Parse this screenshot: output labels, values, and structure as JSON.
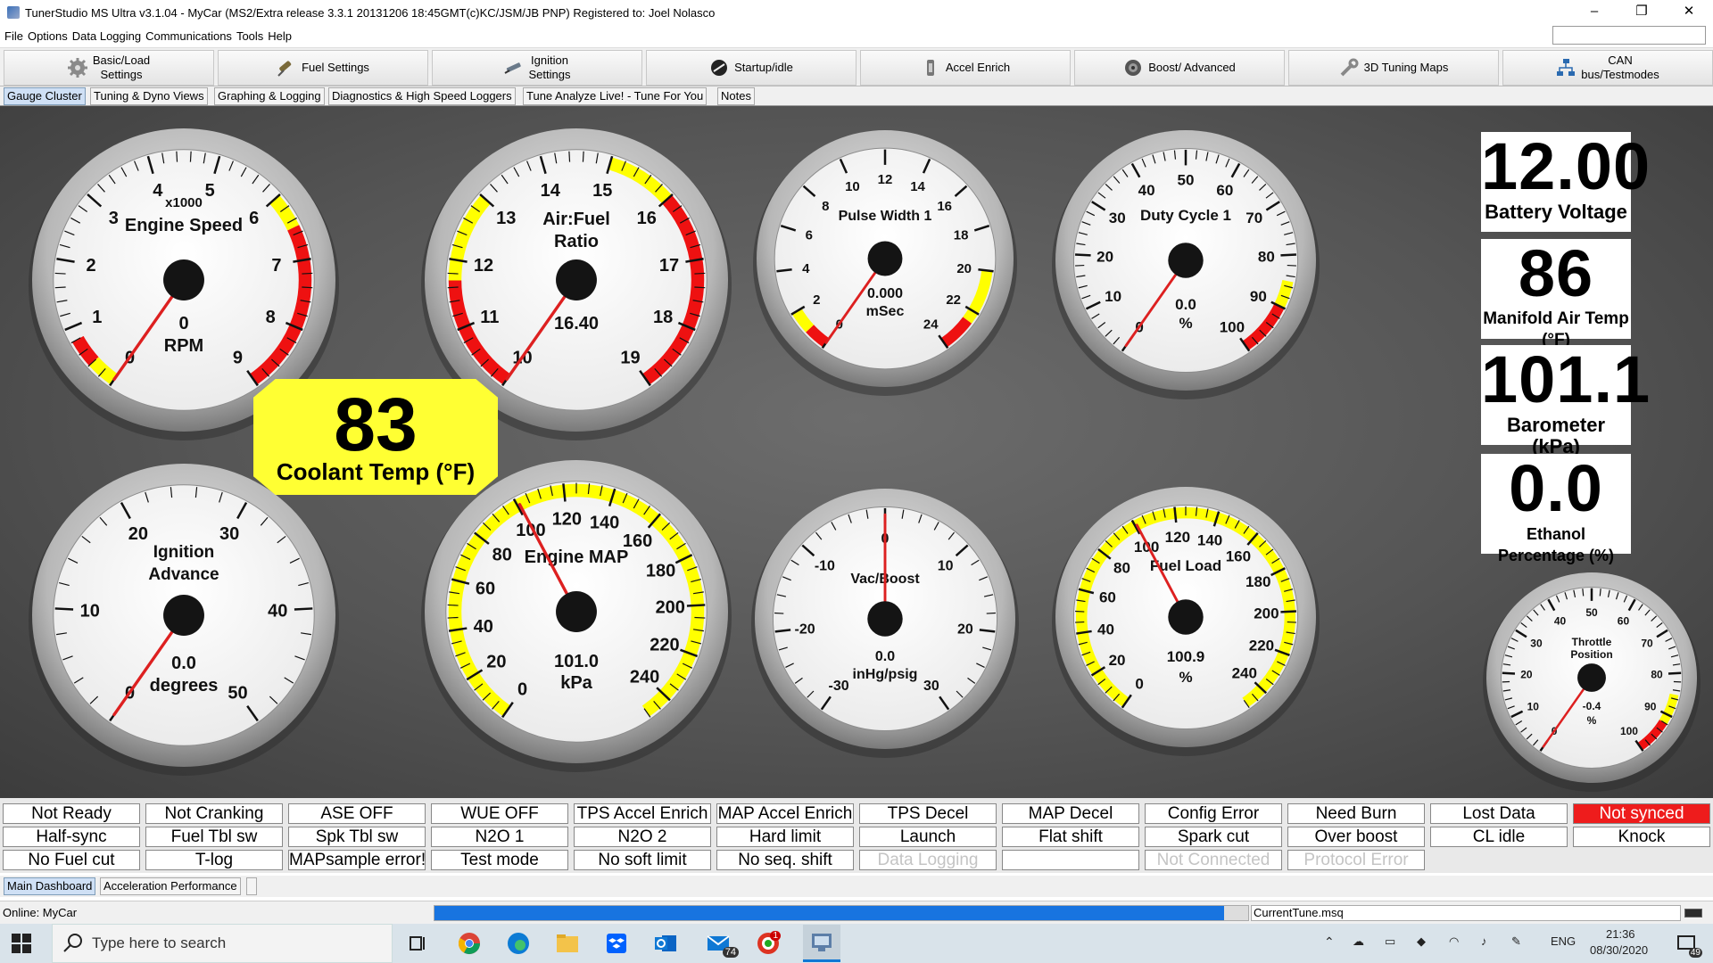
{
  "window": {
    "title": "TunerStudio MS Ultra v3.1.04 - MyCar (MS2/Extra release 3.3.1  20131206 18:45GMT(c)KC/JSM/JB   PNP) Registered to: Joel Nolasco",
    "minimize": "–",
    "maximize": "❐",
    "close": "✕"
  },
  "menu": [
    "File",
    "Options",
    "Data Logging",
    "Communications",
    "Tools",
    "Help"
  ],
  "toolbar": [
    {
      "label": "Basic/Load\nSettings",
      "icon": "gear-icon"
    },
    {
      "label": "Fuel Settings",
      "icon": "fuel-injector-icon"
    },
    {
      "label": "Ignition\nSettings",
      "icon": "spark-plug-icon"
    },
    {
      "label": "Startup/idle",
      "icon": "startup-icon"
    },
    {
      "label": "Accel Enrich",
      "icon": "throttle-icon"
    },
    {
      "label": "Boost/ Advanced",
      "icon": "turbo-icon"
    },
    {
      "label": "3D Tuning Maps",
      "icon": "wrench-icon"
    },
    {
      "label": "CAN\nbus/Testmodes",
      "icon": "network-icon"
    }
  ],
  "tabs": [
    "Gauge Cluster",
    "Tuning & Dyno Views",
    "Graphing & Logging",
    "Diagnostics & High Speed Loggers",
    "Tune Analyze Live! - Tune For You",
    "Notes"
  ],
  "active_tab": "Gauge Cluster",
  "gauges": {
    "engine_speed": {
      "title1": "x1000",
      "title2": "Engine Speed",
      "value": "0",
      "units": "RPM",
      "ticks": [
        "0",
        "1",
        "2",
        "3",
        "4",
        "5",
        "6",
        "7",
        "8",
        "9"
      ]
    },
    "afr": {
      "title1": "Air:Fuel",
      "title2": "Ratio",
      "value": "16.40",
      "units": "",
      "ticks": [
        "10",
        "11",
        "12",
        "13",
        "14",
        "15",
        "16",
        "17",
        "18",
        "19"
      ]
    },
    "pulse_width": {
      "title1": "Pulse Width 1",
      "value": "0.000",
      "units": "mSec",
      "ticks": [
        "0",
        "2",
        "4",
        "6",
        "8",
        "10",
        "12",
        "14",
        "16",
        "18",
        "20",
        "22",
        "24"
      ]
    },
    "duty_cycle": {
      "title1": "Duty Cycle 1",
      "value": "0.0",
      "units": "%",
      "ticks": [
        "0",
        "10",
        "20",
        "30",
        "40",
        "50",
        "60",
        "70",
        "80",
        "90",
        "100"
      ]
    },
    "ignition_advance": {
      "title1": "Ignition",
      "title2": "Advance",
      "value": "0.0",
      "units": "degrees",
      "ticks": [
        "0",
        "10",
        "20",
        "30",
        "40",
        "50"
      ]
    },
    "engine_map": {
      "title1": "Engine MAP",
      "value": "101.0",
      "units": "kPa",
      "ticks": [
        "0",
        "20",
        "40",
        "60",
        "80",
        "100",
        "120",
        "140",
        "160",
        "180",
        "200",
        "220",
        "240"
      ]
    },
    "vac_boost": {
      "title1": "Vac/Boost",
      "value": "0.0",
      "units": "inHg/psig",
      "ticks": [
        "-30",
        "-20",
        "-10",
        "0",
        "10",
        "20",
        "30"
      ]
    },
    "fuel_load": {
      "title1": "Fuel Load",
      "value": "100.9",
      "units": "%",
      "ticks": [
        "0",
        "20",
        "40",
        "60",
        "80",
        "100",
        "120",
        "140",
        "160",
        "180",
        "200",
        "220",
        "240"
      ]
    },
    "throttle": {
      "title1": "Throttle",
      "title2": "Position",
      "value": "-0.4",
      "units": "%",
      "ticks": [
        "0",
        "10",
        "20",
        "30",
        "40",
        "50",
        "60",
        "70",
        "80",
        "90",
        "100"
      ]
    }
  },
  "coolant": {
    "value": "83",
    "label": "Coolant Temp (°F)"
  },
  "digital": [
    {
      "value": "12.00",
      "label": "Battery Voltage"
    },
    {
      "value": "86",
      "label": "Manifold Air Temp (°F)"
    },
    {
      "value": "101.1",
      "label": "Barometer (kPa)"
    },
    {
      "value": "0.0",
      "label": "Ethanol Percentage (%)"
    }
  ],
  "indicators": [
    [
      "Not Ready",
      "Not Cranking",
      "ASE OFF",
      "WUE OFF",
      "TPS Accel Enrich",
      "MAP Accel Enrich",
      "TPS Decel",
      "MAP Decel",
      "Config Error",
      "Need Burn",
      "Lost Data",
      "Not synced"
    ],
    [
      "Half-sync",
      "Fuel Tbl sw",
      "Spk Tbl sw",
      "N2O 1",
      "N2O 2",
      "Hard limit",
      "Launch",
      "Flat shift",
      "Spark cut",
      "Over boost",
      "CL idle",
      "Knock"
    ],
    [
      "No Fuel cut",
      "T-log",
      "MAPsample error!",
      "Test mode",
      "No soft limit",
      "No seq. shift",
      "Data Logging",
      "",
      "Not Connected",
      "Protocol Error"
    ]
  ],
  "bottom_tabs": [
    "Main Dashboard",
    "Acceleration Performance"
  ],
  "status": {
    "online": "Online: MyCar",
    "progress": 0.97,
    "file": "CurrentTune.msq"
  },
  "taskbar": {
    "search_placeholder": "Type here to search",
    "mail_badge": "74",
    "app_badge": "1",
    "lang": "ENG",
    "time": "21:36",
    "date": "08/30/2020",
    "notif": "49"
  }
}
